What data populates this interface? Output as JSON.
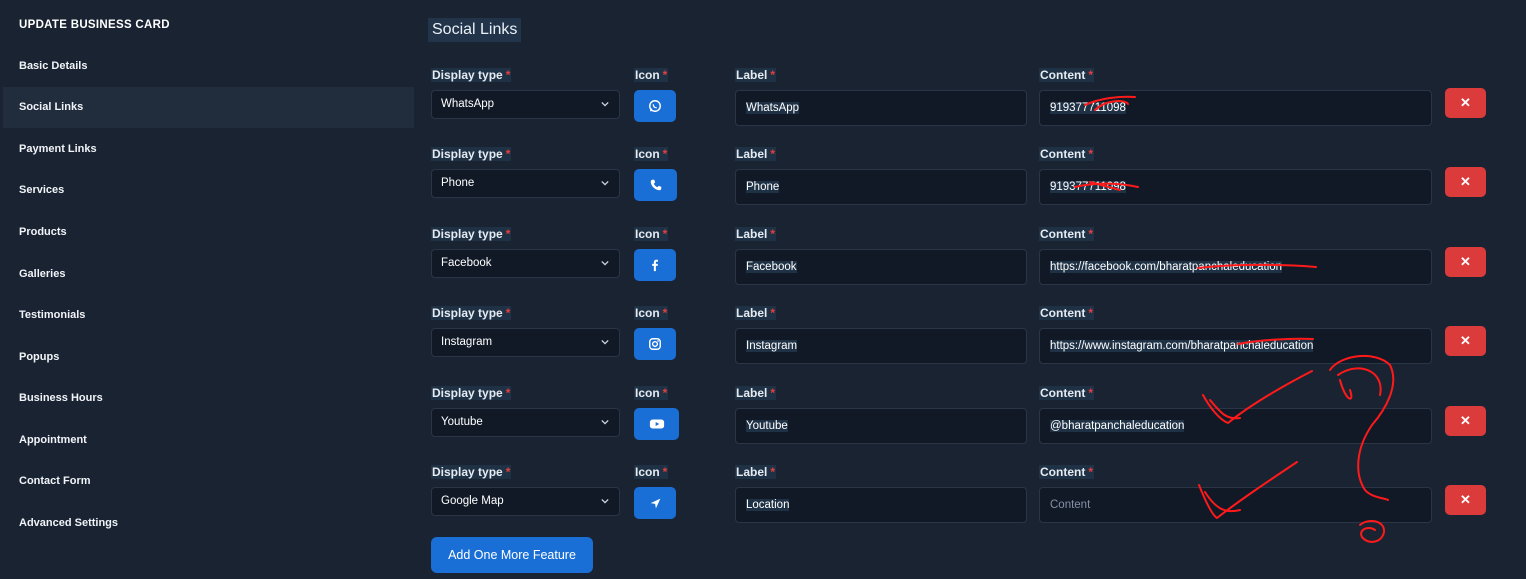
{
  "sidebar": {
    "title": "UPDATE BUSINESS CARD",
    "items": [
      {
        "label": "Basic Details"
      },
      {
        "label": "Social Links"
      },
      {
        "label": "Payment Links"
      },
      {
        "label": "Services"
      },
      {
        "label": "Products"
      },
      {
        "label": "Galleries"
      },
      {
        "label": "Testimonials"
      },
      {
        "label": "Popups"
      },
      {
        "label": "Business Hours"
      },
      {
        "label": "Appointment"
      },
      {
        "label": "Contact Form"
      },
      {
        "label": "Advanced Settings"
      }
    ],
    "active": "Social Links"
  },
  "main": {
    "section_title": "Social Links",
    "labels": {
      "display_type": "Display type",
      "icon": "Icon",
      "label": "Label",
      "content": "Content",
      "required": "*"
    },
    "rows": [
      {
        "display_type": "WhatsApp",
        "icon": "whatsapp-icon",
        "label": "WhatsApp",
        "content": "919377711098",
        "delete": "✕"
      },
      {
        "display_type": "Phone",
        "icon": "phone-icon",
        "label": "Phone",
        "content": "919377711098",
        "delete": "✕"
      },
      {
        "display_type": "Facebook",
        "icon": "facebook-icon",
        "label": "Facebook",
        "content": "https://facebook.com/bharatpanchaleducation",
        "delete": "✕"
      },
      {
        "display_type": "Instagram",
        "icon": "instagram-icon",
        "label": "Instagram",
        "content": "https://www.instagram.com/bharatpanchaleducation",
        "delete": "✕"
      },
      {
        "display_type": "Youtube",
        "icon": "youtube-icon",
        "label": "Youtube",
        "content": "@bharatpanchaleducation",
        "delete": "✕"
      },
      {
        "display_type": "Google Map",
        "icon": "location-arrow-icon",
        "label": "Location",
        "content": "",
        "content_placeholder": "Content",
        "delete": "✕"
      }
    ],
    "add_button": "Add One More Feature"
  },
  "colors": {
    "background": "#1a2332",
    "input_bg": "#111927",
    "primary": "#1a6fd6",
    "danger": "#dc3b3b",
    "required": "#e53e3e",
    "annotation": "#ff1a1a"
  }
}
